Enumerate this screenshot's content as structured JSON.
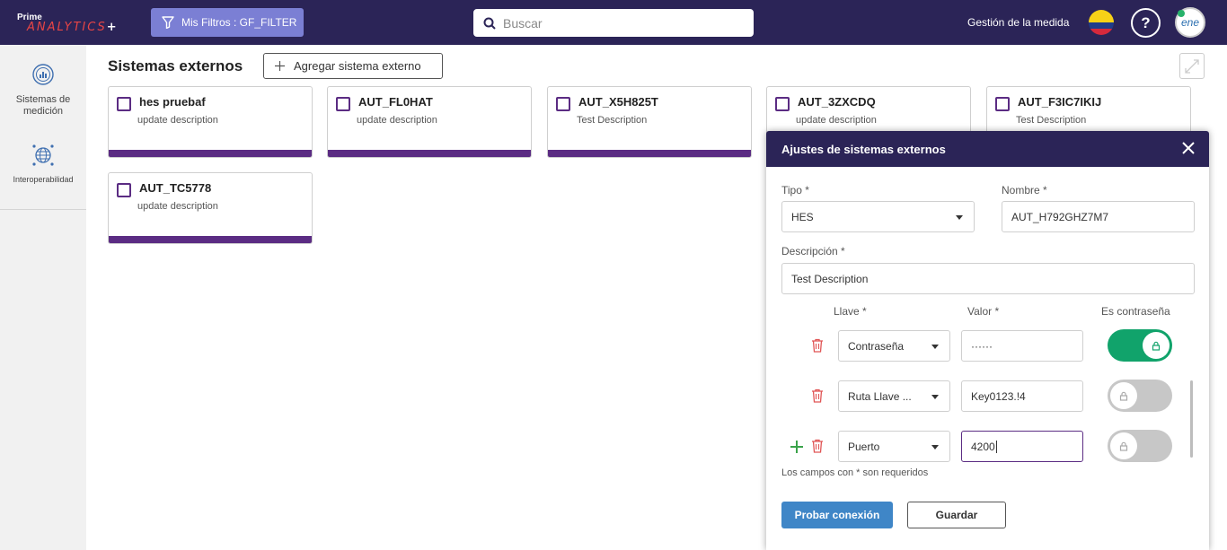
{
  "header": {
    "logo_prime": "Prime",
    "logo_analytics": "ANALYTICS",
    "logo_plus": "+",
    "filter_label": "Mis Filtros : GF_FILTER",
    "search_placeholder": "Buscar",
    "management_label": "Gestión de la medida",
    "help_label": "?",
    "avatar_label": "ene"
  },
  "sidebar": {
    "items": [
      {
        "label": "Sistemas de medición",
        "icon": "chart-circle-icon"
      },
      {
        "label": "Interoperabilidad",
        "icon": "globe-network-icon"
      }
    ]
  },
  "main": {
    "title": "Sistemas externos",
    "add_button": "Agregar sistema externo",
    "cards": [
      {
        "name": "hes pruebaf",
        "description": "update description"
      },
      {
        "name": "AUT_FL0HAT",
        "description": "update description"
      },
      {
        "name": "AUT_X5H825T",
        "description": "Test Description"
      },
      {
        "name": "AUT_3ZXCDQ",
        "description": "update description"
      },
      {
        "name": "AUT_F3IC7IKIJ",
        "description": "Test Description"
      },
      {
        "name": "AUT_TC5778",
        "description": "update description"
      }
    ]
  },
  "dialog": {
    "title": "Ajustes de sistemas externos",
    "tipo_label": "Tipo *",
    "tipo_value": "HES",
    "nombre_label": "Nombre *",
    "nombre_value": "AUT_H792GHZ7M7",
    "descripcion_label": "Descripción *",
    "descripcion_value": "Test Description",
    "llave_header": "Llave *",
    "valor_header": "Valor *",
    "password_header": "Es contraseña",
    "rows": [
      {
        "key": "Contraseña",
        "value": "······",
        "is_password": true
      },
      {
        "key": "Ruta Llave ...",
        "value": "Key0123.!4",
        "is_password": false
      },
      {
        "key": "Puerto",
        "value": "4200",
        "is_password": false
      }
    ],
    "required_note": "Los campos con * son requeridos",
    "test_button": "Probar conexión",
    "save_button": "Guardar"
  },
  "colors": {
    "topbar": "#2b2457",
    "accent_purple": "#5b2c83",
    "toggle_on": "#11a36b",
    "primary_button": "#3f86c7"
  }
}
